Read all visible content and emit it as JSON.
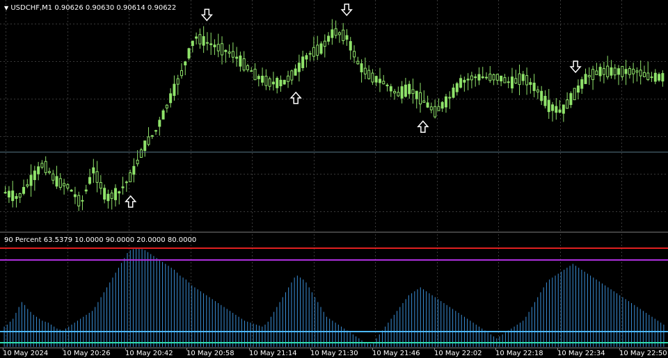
{
  "chart_header": {
    "symbol": "USDCHF,M1",
    "prices": "0.90626 0.90630 0.90614 0.90622"
  },
  "indicator_header": {
    "label": "90 Percent 63.5379 10.0000 90.0000 20.0000 80.0000"
  },
  "colors": {
    "background": "#000000",
    "grid": "#3a3a3a",
    "candle": "#8fe36a",
    "price_line": "#5a7a8a",
    "arrow": "#ffffff",
    "level_90": "#e02020",
    "level_80": "#b030e0",
    "level_20": "#4db8ff",
    "level_10": "#30e0b0",
    "histogram": "#3a8fd8"
  },
  "x_axis": {
    "labels": [
      "10 May 2024",
      "10 May 20:26",
      "10 May 20:42",
      "10 May 20:58",
      "10 May 21:14",
      "10 May 21:30",
      "10 May 21:46",
      "10 May 22:02",
      "10 May 22:18",
      "10 May 22:34",
      "10 May 22:50"
    ]
  },
  "chart_data": [
    {
      "type": "candlestick",
      "title": "USDCHF,M1",
      "series_trend": [
        0.90608,
        0.90606,
        0.90612,
        0.90618,
        0.90612,
        0.9061,
        0.90604,
        0.90616,
        0.90606,
        0.90608,
        0.90614,
        0.90624,
        0.9063,
        0.9064,
        0.9065,
        0.90662,
        0.9066,
        0.90658,
        0.90656,
        0.90652,
        0.90648,
        0.90646,
        0.90646,
        0.9065,
        0.90656,
        0.90658,
        0.90664,
        0.90662,
        0.90652,
        0.90648,
        0.90646,
        0.90642,
        0.90644,
        0.9064,
        0.90636,
        0.9064,
        0.90646,
        0.90648,
        0.90648,
        0.90648,
        0.90646,
        0.90648,
        0.90644,
        0.90638,
        0.90636,
        0.90642,
        0.90648,
        0.9065,
        0.9065,
        0.9065,
        0.9065,
        0.90648,
        0.90648
      ],
      "current_price": 0.90622,
      "markers": [
        {
          "type": "up",
          "index": 10
        },
        {
          "type": "down",
          "index": 16
        },
        {
          "type": "up",
          "index": 23
        },
        {
          "type": "down",
          "index": 27
        },
        {
          "type": "up",
          "index": 33
        },
        {
          "type": "down",
          "index": 45
        }
      ]
    },
    {
      "type": "histogram",
      "title": "90 Percent",
      "levels": [
        10,
        20,
        80,
        90
      ],
      "ylim": [
        0,
        100
      ],
      "values": [
        20,
        22,
        25,
        28,
        34,
        40,
        45,
        42,
        38,
        35,
        32,
        30,
        28,
        26,
        25,
        24,
        22,
        20,
        18,
        17,
        16,
        18,
        20,
        22,
        24,
        26,
        28,
        30,
        32,
        34,
        36,
        40,
        45,
        50,
        55,
        60,
        65,
        70,
        75,
        80,
        85,
        90,
        95,
        98,
        99,
        100,
        100,
        99,
        98,
        96,
        94,
        92,
        90,
        88,
        86,
        84,
        82,
        80,
        78,
        75,
        72,
        70,
        68,
        65,
        62,
        60,
        58,
        56,
        54,
        52,
        50,
        48,
        46,
        44,
        42,
        40,
        38,
        36,
        34,
        32,
        30,
        28,
        26,
        25,
        24,
        23,
        22,
        21,
        20,
        22,
        25,
        30,
        35,
        40,
        45,
        50,
        55,
        60,
        65,
        70,
        72,
        70,
        68,
        65,
        60,
        55,
        50,
        45,
        40,
        35,
        30,
        28,
        26,
        24,
        22,
        20,
        18,
        16,
        14,
        12,
        10,
        8,
        6,
        4,
        3,
        2,
        4,
        8,
        12,
        16,
        20,
        24,
        28,
        32,
        36,
        40,
        44,
        48,
        52,
        54,
        56,
        58,
        60,
        58,
        56,
        54,
        52,
        50,
        48,
        46,
        44,
        42,
        40,
        38,
        36,
        34,
        32,
        30,
        28,
        26,
        24,
        22,
        20,
        18,
        16,
        14,
        12,
        10,
        8,
        10,
        12,
        14,
        16,
        18,
        20,
        22,
        24,
        26,
        30,
        35,
        40,
        45,
        50,
        55,
        60,
        65,
        68,
        70,
        72,
        74,
        76,
        78,
        80,
        82,
        84,
        82,
        80,
        78,
        76,
        74,
        72,
        70,
        68,
        66,
        64,
        62,
        60,
        58,
        56,
        54,
        52,
        50,
        48,
        46,
        44,
        42,
        40,
        38,
        36,
        34,
        32,
        30,
        28,
        26,
        24,
        22
      ]
    }
  ]
}
